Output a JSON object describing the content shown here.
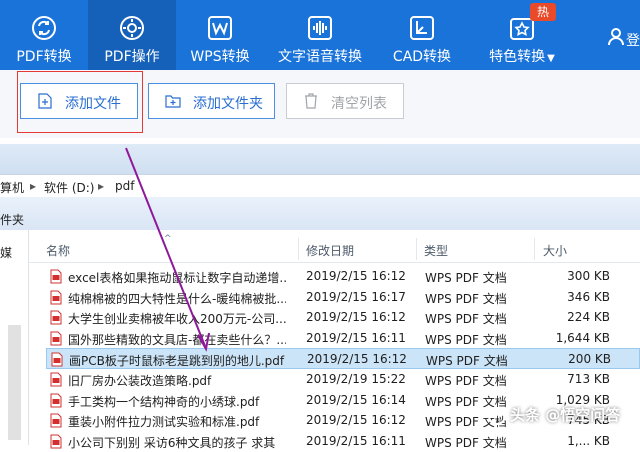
{
  "topbar": {
    "items": [
      {
        "label": "PDF转换",
        "icon": "refresh-icon"
      },
      {
        "label": "PDF操作",
        "icon": "gear-icon",
        "active": true
      },
      {
        "label": "WPS转换",
        "icon": "wps-icon"
      },
      {
        "label": "文字语音转换",
        "icon": "soundwave-icon"
      },
      {
        "label": "CAD转换",
        "icon": "cad-icon"
      },
      {
        "label": "特色转换",
        "icon": "star-icon",
        "dropdown": true
      }
    ],
    "hot_badge": "热",
    "user_glyph": "登",
    "colors": {
      "bar": "#1a73d9",
      "active": "#1560b8"
    }
  },
  "actions": {
    "add_file": "添加文件",
    "add_folder": "添加文件夹",
    "clear_list": "清空列表"
  },
  "explorer": {
    "address": {
      "computer": "算机",
      "drive": "软件 (D:)",
      "folder": "pdf"
    },
    "folder_label": "件夹",
    "nav_label": "媒",
    "columns": {
      "name": "名称",
      "date": "修改日期",
      "type": "类型",
      "size": "大小"
    },
    "files": [
      {
        "name": "excel表格如果拖动鼠标让数字自动递增...",
        "date": "2019/2/15 16:12",
        "type": "WPS PDF 文档",
        "size": "300 KB"
      },
      {
        "name": "纯棉棉被的四大特性是什么-暖纯棉被批...",
        "date": "2019/2/15 16:17",
        "type": "WPS PDF 文档",
        "size": "346 KB"
      },
      {
        "name": "大学生创业卖棉被年收入200万元-公司...",
        "date": "2019/2/15 16:12",
        "type": "WPS PDF 文档",
        "size": "224 KB"
      },
      {
        "name": "国外那些精致的文具店-都在卖些什么？...",
        "date": "2019/2/15 16:11",
        "type": "WPS PDF 文档",
        "size": "1,644 KB"
      },
      {
        "name": "画PCB板子时鼠标老是跳到别的地儿.pdf",
        "date": "2019/2/15 16:12",
        "type": "WPS PDF 文档",
        "size": "200 KB",
        "selected": true
      },
      {
        "name": "旧厂房办公装改造策略.pdf",
        "date": "2019/2/19 15:22",
        "type": "WPS PDF 文档",
        "size": "713 KB"
      },
      {
        "name": "手工类构一个结构神奇的小绣球.pdf",
        "date": "2019/2/15 16:14",
        "type": "WPS PDF 文档",
        "size": "1,029 KB"
      },
      {
        "name": "重装小附件拉力测试实验和标准.pdf",
        "date": "2019/2/15 16:12",
        "type": "WPS PDF 文档",
        "size": "745 KB"
      },
      {
        "name": "小公司下别别 采访6种文具的孩子 求其",
        "date": "2019/2/15 16:11",
        "type": "WPS PDF 文档",
        "size": "1,... KB"
      }
    ]
  },
  "watermark": "头条 @悟空问答"
}
